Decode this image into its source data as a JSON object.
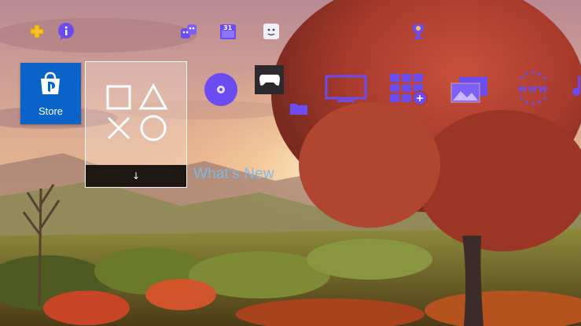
{
  "top_bar": {
    "icons": [
      "playstation-plus-icon",
      "notifications-icon",
      "friends-icon",
      "events-calendar-icon",
      "profile-icon",
      "trophies-icon"
    ],
    "calendar_day": "31"
  },
  "store_tile": {
    "label": "Store",
    "icon": "playstation-bag-icon"
  },
  "whats_new": {
    "caption": "What's New",
    "symbols": [
      "square",
      "triangle",
      "cross",
      "circle"
    ],
    "arrow": "↓"
  },
  "apps": [
    "disc-icon",
    "gamepad-icon",
    "folder-icon",
    "tv-video-icon",
    "library-icon",
    "capture-gallery-icon",
    "internet-browser-icon"
  ],
  "colors": {
    "accent_purple": "#6a4cf0",
    "store_blue": "#0a63c9",
    "caption_blue": "#7eb9e7",
    "plus_yellow": "#f6c122"
  }
}
